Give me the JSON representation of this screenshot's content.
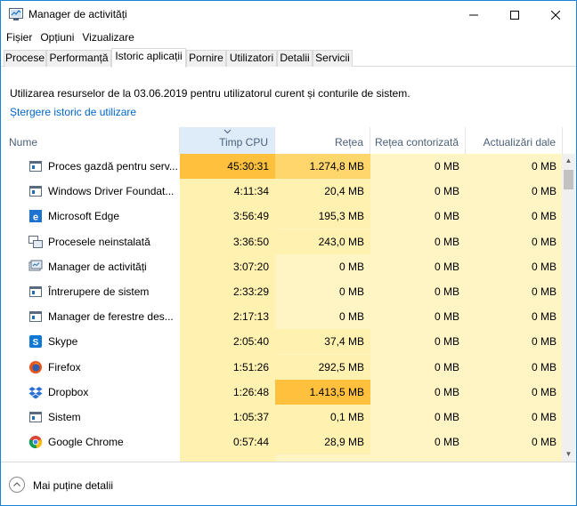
{
  "window": {
    "title": "Manager de activități",
    "minimize_icon": "minimize-icon",
    "maximize_icon": "maximize-icon",
    "close_icon": "close-icon"
  },
  "menu": [
    "Fișier",
    "Opțiuni",
    "Vizualizare"
  ],
  "tabs": [
    {
      "label": "Procese",
      "active": false
    },
    {
      "label": "Performanță",
      "active": false
    },
    {
      "label": "Istoric aplicații",
      "active": true
    },
    {
      "label": "Pornire",
      "active": false
    },
    {
      "label": "Utilizatori",
      "active": false
    },
    {
      "label": "Detalii",
      "active": false
    },
    {
      "label": "Servicii",
      "active": false
    }
  ],
  "info_text": "Utilizarea resurselor de la 03.06.2019 pentru utilizatorul curent și conturile de sistem.",
  "delete_history_link": "Ștergere istoric de utilizare",
  "columns": {
    "name": "Nume",
    "cpu": "Timp CPU",
    "network": "Rețea",
    "metered": "Rețea contorizată",
    "updates": "Actualizări dale"
  },
  "rows": [
    {
      "icon": "host-process-icon",
      "name": "Proces gazdă pentru serv...",
      "cpu": "45:30:31",
      "network": "1.274,8 MB",
      "metered": "0 MB",
      "updates": "0 MB",
      "cpu_heat": "high",
      "net_heat": "mid"
    },
    {
      "icon": "driver-foundation-icon",
      "name": "Windows Driver Foundat...",
      "cpu": "4:11:34",
      "network": "20,4 MB",
      "metered": "0 MB",
      "updates": "0 MB",
      "cpu_heat": "low",
      "net_heat": "low"
    },
    {
      "icon": "edge-icon",
      "name": "Microsoft Edge",
      "cpu": "3:56:49",
      "network": "195,3 MB",
      "metered": "0 MB",
      "updates": "0 MB",
      "cpu_heat": "low",
      "net_heat": "low"
    },
    {
      "icon": "processes-icon",
      "name": "Procesele neinstalată",
      "cpu": "3:36:50",
      "network": "243,0 MB",
      "metered": "0 MB",
      "updates": "0 MB",
      "cpu_heat": "low",
      "net_heat": "low"
    },
    {
      "icon": "task-manager-icon",
      "name": "Manager de activități",
      "cpu": "3:07:20",
      "network": "0 MB",
      "metered": "0 MB",
      "updates": "0 MB",
      "cpu_heat": "low",
      "net_heat": "none"
    },
    {
      "icon": "system-interrupt-icon",
      "name": "Întrerupere de sistem",
      "cpu": "2:33:29",
      "network": "0 MB",
      "metered": "0 MB",
      "updates": "0 MB",
      "cpu_heat": "low",
      "net_heat": "none"
    },
    {
      "icon": "window-manager-icon",
      "name": "Manager de ferestre des...",
      "cpu": "2:17:13",
      "network": "0 MB",
      "metered": "0 MB",
      "updates": "0 MB",
      "cpu_heat": "low",
      "net_heat": "none"
    },
    {
      "icon": "skype-icon",
      "name": "Skype",
      "cpu": "2:05:40",
      "network": "37,4 MB",
      "metered": "0 MB",
      "updates": "0 MB",
      "cpu_heat": "low",
      "net_heat": "low"
    },
    {
      "icon": "firefox-icon",
      "name": "Firefox",
      "cpu": "1:51:26",
      "network": "292,5 MB",
      "metered": "0 MB",
      "updates": "0 MB",
      "cpu_heat": "low",
      "net_heat": "low"
    },
    {
      "icon": "dropbox-icon",
      "name": "Dropbox",
      "cpu": "1:26:48",
      "network": "1.413,5 MB",
      "metered": "0 MB",
      "updates": "0 MB",
      "cpu_heat": "low",
      "net_heat": "high"
    },
    {
      "icon": "system-icon",
      "name": "Sistem",
      "cpu": "1:05:37",
      "network": "0,1 MB",
      "metered": "0 MB",
      "updates": "0 MB",
      "cpu_heat": "low",
      "net_heat": "low"
    },
    {
      "icon": "chrome-icon",
      "name": "Google Chrome",
      "cpu": "0:57:44",
      "network": "28,9 MB",
      "metered": "0 MB",
      "updates": "0 MB",
      "cpu_heat": "low",
      "net_heat": "low"
    }
  ],
  "footer": {
    "fewer_details_label": "Mai puține detalii",
    "fewer_details_icon": "chevron-up-circle-icon"
  },
  "colors": {
    "accent": "#1883d7",
    "link": "#0066cc",
    "heat_none": "#fff4c4",
    "heat_low": "#fff1b0",
    "heat_mid": "#ffd66b",
    "heat_high": "#ffc13d",
    "sorted_header": "#deecf9"
  }
}
